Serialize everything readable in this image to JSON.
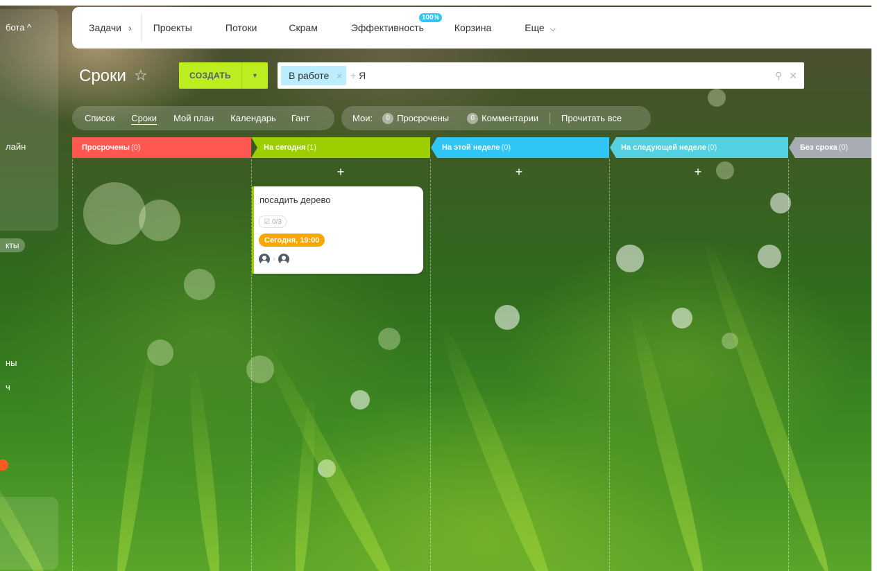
{
  "left_panel": {
    "items": [
      "бота ^",
      "лайн",
      "кты",
      "ны",
      "ч"
    ]
  },
  "topnav": {
    "items": [
      "Задачи",
      "Проекты",
      "Потоки",
      "Скрам",
      "Эффективность",
      "Корзина",
      "Еще"
    ],
    "efficiency_badge": "100%"
  },
  "header": {
    "title": "Сроки",
    "create_label": "СОЗДАТЬ",
    "filter_chip": "В работе",
    "filter_me": "Я"
  },
  "views": {
    "items": [
      "Список",
      "Сроки",
      "Мой план",
      "Календарь",
      "Гант"
    ],
    "active": "Сроки"
  },
  "counters": {
    "label": "Мои:",
    "overdue_count": "0",
    "overdue_label": "Просрочены",
    "comments_count": "0",
    "comments_label": "Комментарии",
    "read_all": "Прочитать все"
  },
  "columns": [
    {
      "title": "Просрочены",
      "count": "(0)",
      "color": "#ff5752"
    },
    {
      "title": "На сегодня",
      "count": "(1)",
      "color": "#9dcf00"
    },
    {
      "title": "На этой неделе",
      "count": "(0)",
      "color": "#2fc6f6"
    },
    {
      "title": "На следующей неделе",
      "count": "(0)",
      "color": "#55d0e0"
    },
    {
      "title": "Без срока",
      "count": "(0)",
      "color": "#a8adb4"
    }
  ],
  "card": {
    "title": "посадить дерево",
    "checklist": "0/3",
    "deadline": "Сегодня, 19:00"
  },
  "colors": {
    "create": "#bbed21",
    "chip": "#bcedfc",
    "deadline": "#f7a700"
  }
}
